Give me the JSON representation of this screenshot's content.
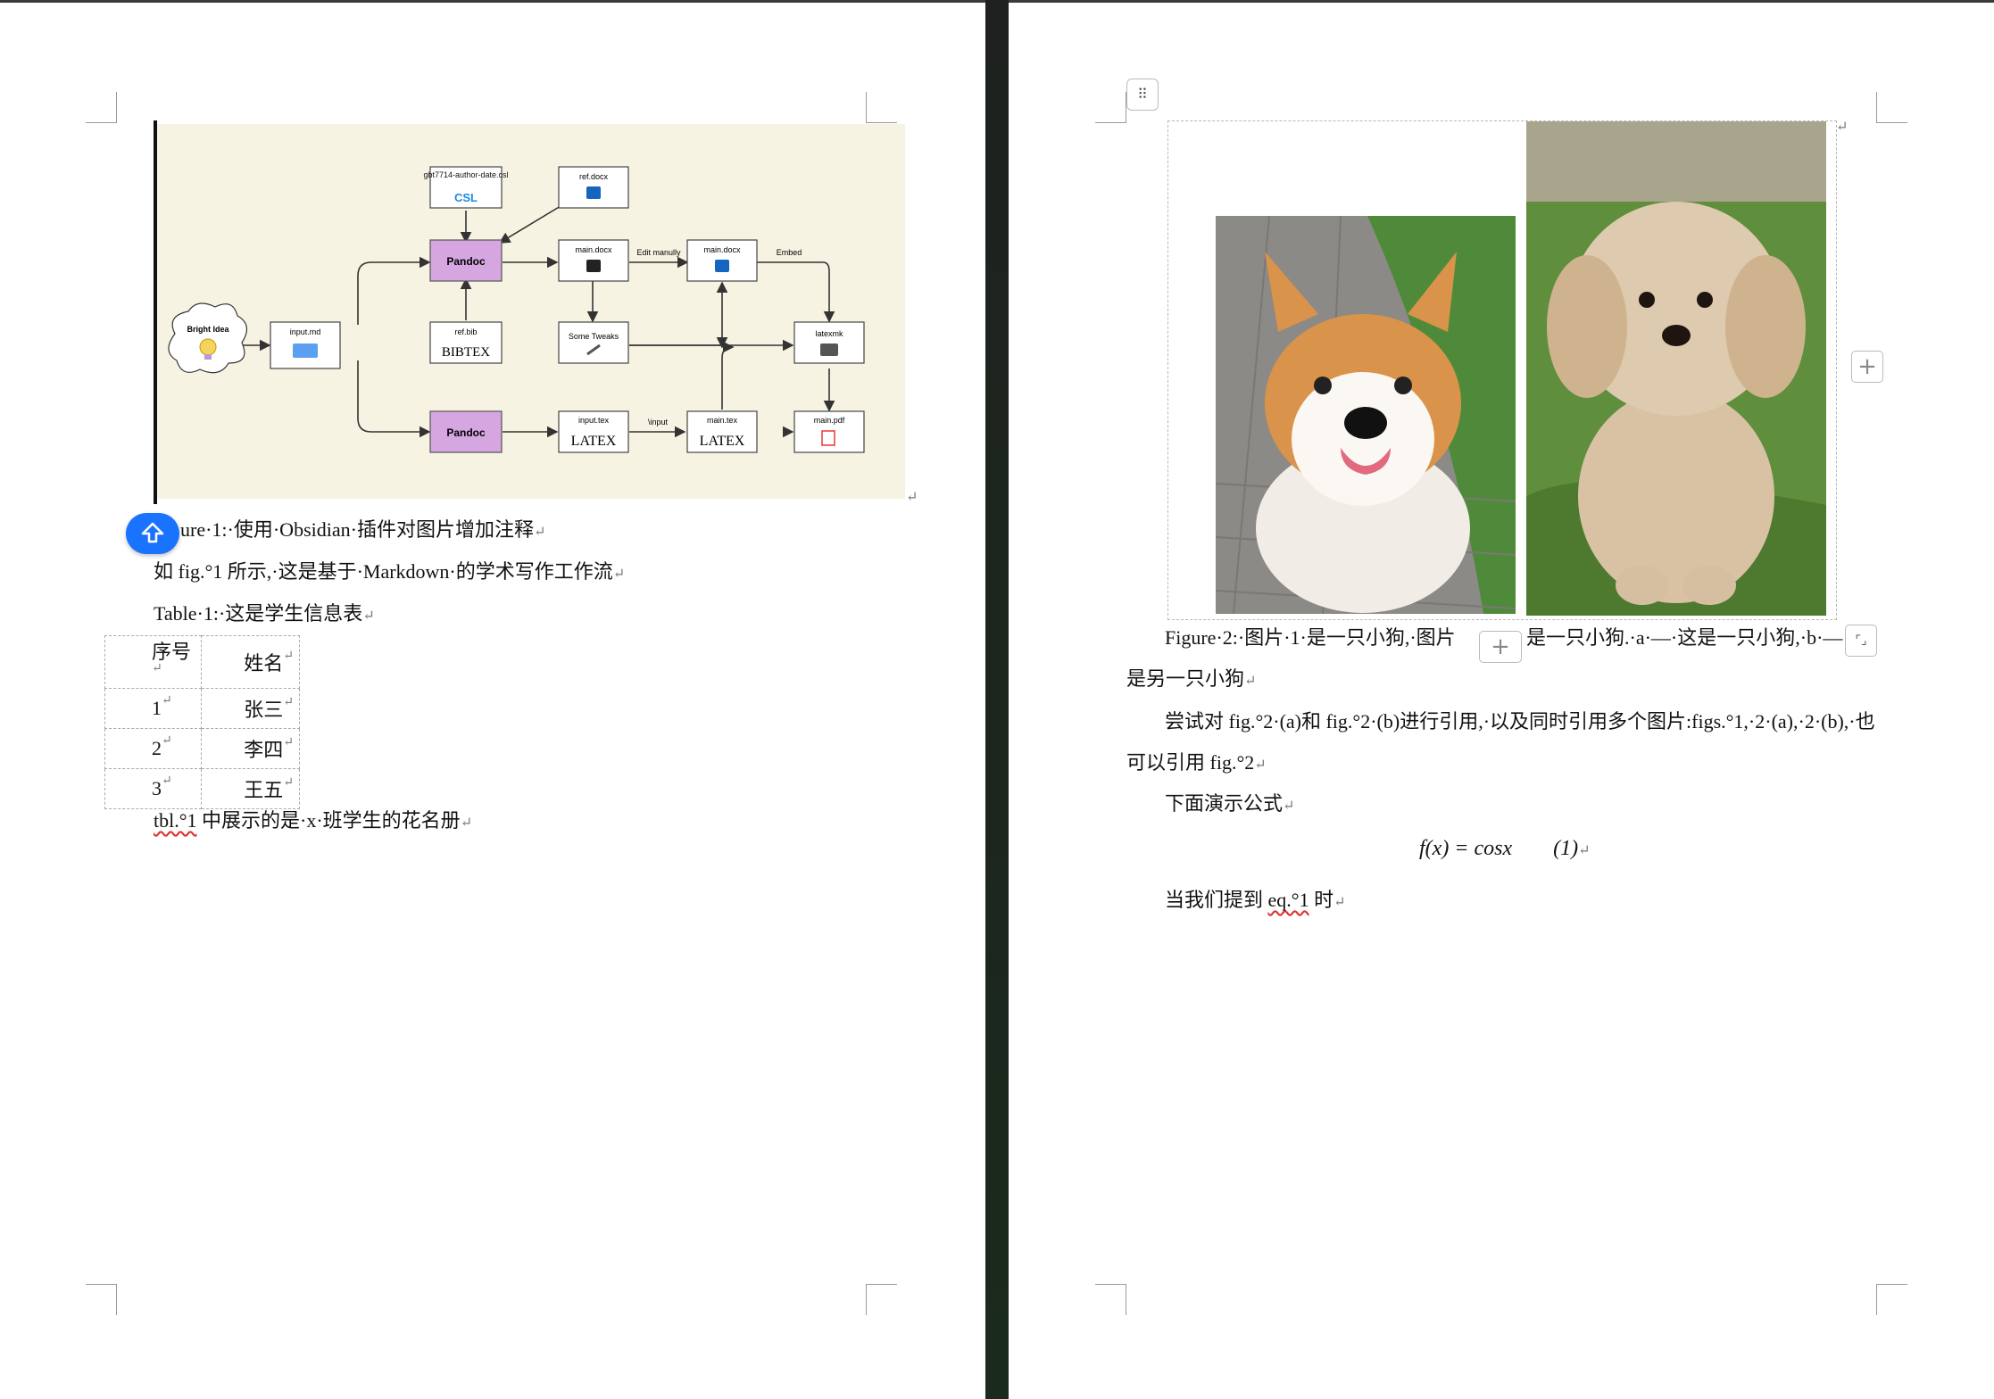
{
  "left_page": {
    "diagram": {
      "nodes": {
        "csl": "gbt7714-author-date.csl",
        "csl_logo": "CSL",
        "refdocx": "ref.docx",
        "pandoc_top": "Pandoc",
        "main_docx_1": "main.docx",
        "main_docx_2": "main.docx",
        "bright_idea": "Bright Idea",
        "input_md": "input.md",
        "ref_bib": "ref.bib",
        "bibtex": "BIBTEX",
        "some_tweaks": "Some Tweaks",
        "latexmk": "latexmk",
        "pandoc_bottom": "Pandoc",
        "input_tex": "input.tex",
        "main_tex": "main.tex",
        "main_pdf": "main.pdf",
        "latex_logo": "LATEX"
      },
      "edges": {
        "edit_manually": "Edit manully",
        "embed": "Embed",
        "input_cmd": "\\input"
      }
    },
    "figure1_caption": "ure·1:·使用·Obsidian·插件对图片增加注释",
    "para1": "如 fig.°1 所示,·这是基于·Markdown·的学术写作工作流",
    "table_caption": "Table·1:·这是学生信息表",
    "table": {
      "headers": [
        "序号",
        "姓名"
      ],
      "rows": [
        [
          "1",
          "张三"
        ],
        [
          "2",
          "李四"
        ],
        [
          "3",
          "王五"
        ]
      ]
    },
    "para2_ref": "tbl.°1",
    "para2_rest": " 中展示的是·x·班学生的花名册"
  },
  "right_page": {
    "figure2_caption_a": "Figure·2:·图片·1·是一只小狗,·图片",
    "figure2_caption_b": "是一只小狗.·a·—·这是一只小狗,·b·—",
    "figure2_caption_c": "是另一只小狗",
    "para1_a": "尝试对 fig.°2·(a)和 fig.°2·(b)进行引用,·以及同时引用多个图片:figs.°1,·2·(a),·2·(b),·也",
    "para1_b": "可以引用 fig.°2",
    "para2": "下面演示公式",
    "equation": "f(x) = cosx",
    "equation_number": "(1)",
    "para3_a": "当我们提到 ",
    "para3_ref": "eq.°1",
    "para3_b": " 时"
  },
  "ui": {
    "paragraph_mark": "↵",
    "cell_mark": "↵",
    "table_handle_icon": "⠿",
    "plus_icon": "+",
    "resize_icon": "⌜⌟"
  }
}
